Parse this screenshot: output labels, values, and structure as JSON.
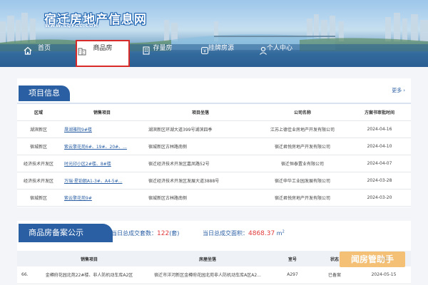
{
  "site": {
    "logo_text": "宿迁房地产信息网",
    "url_text": "WWW.SQFGC.COM"
  },
  "nav": {
    "items": [
      {
        "label": "首页",
        "icon": "home-icon"
      },
      {
        "label": "商品房",
        "icon": "building-icon",
        "active": true
      },
      {
        "label": "存量房",
        "icon": "apartment-icon"
      },
      {
        "label": "挂牌房源",
        "icon": "listing-tag-icon"
      },
      {
        "label": "个人中心",
        "icon": "user-icon"
      }
    ]
  },
  "projects": {
    "title": "项目信息",
    "more": "更多",
    "columns": [
      "区域",
      "销售项目",
      "项目坐落",
      "公司名称",
      "方案书审批时间"
    ],
    "rows": [
      [
        "湖滨新区",
        "晟湖雅院9#楼",
        "湖滨新区环湖大道399号湖滨四季",
        "江苏上德佳业房地产开发有限公司",
        "2024-04-16"
      ],
      [
        "宿城新区",
        "紫云擎花苑6#、19#、20#、...",
        "宿城新区古林路南侧",
        "宿迁君悦房地产开发有限公司",
        "2024-04-10"
      ],
      [
        "经济技术开发区",
        "时光印小区2#楼、8#楼",
        "宿迁经济技术开发区嘉凤路52号",
        "宿迁恒泰置业有限公司",
        "2024-04-07"
      ],
      [
        "经济技术开发区",
        "万瑞·星铂朝A1-3#、A4-5#...",
        "宿迁经济技术开发区发展大道3888号",
        "宿迁申华工业园发展有限公司",
        "2024-03-28"
      ],
      [
        "宿城新区",
        "紫云擎花苑9#",
        "宿城新区古林路南侧",
        "宿迁君悦房地产开发有限公司",
        "2024-03-20"
      ]
    ]
  },
  "filings": {
    "title": "商品房备案公示",
    "stat_count_label": "当日总成交套数：",
    "stat_count_value": "122",
    "stat_count_unit": "(套)",
    "stat_area_label": "当日总成交面积：",
    "stat_area_value": "4868.37",
    "stat_area_unit": "m",
    "stat_area_sup": "2",
    "columns": [
      "",
      "销售项目",
      "房屋坐落",
      "室号",
      "状态",
      "日期"
    ],
    "rows": [
      [
        "66.",
        "金樽府花园北苑22#楼、非人防机动车库A2区",
        "宿迁市洋河新区金樽府花园北苑非人防机动车库A区A2...",
        "A297",
        "已备案",
        "2024-05-15"
      ]
    ]
  },
  "watermark": "闻房管助手",
  "colors": {
    "primary": "#2a5fa3",
    "highlight": "#d92a2a",
    "accent_number": "#e03b3b",
    "watermark": "#f4b860"
  }
}
